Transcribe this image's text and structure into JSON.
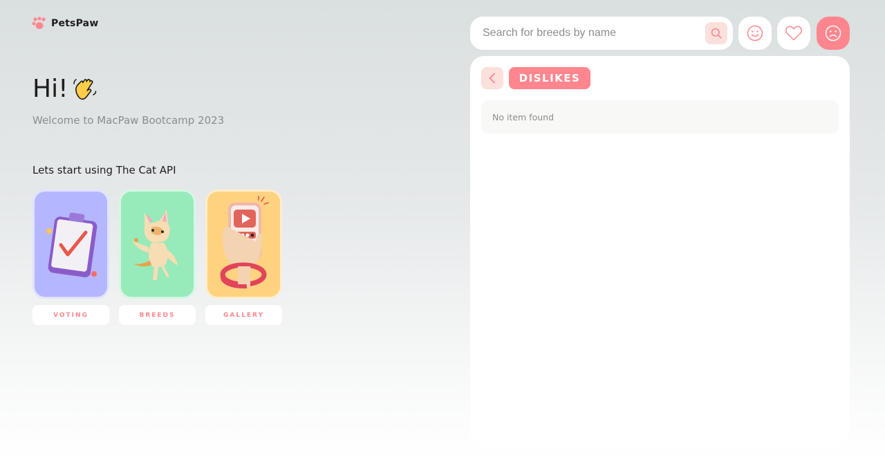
{
  "brand": {
    "name": "PetsPaw",
    "accent": "#ff868e",
    "accent_light": "#fbe0dc"
  },
  "hero": {
    "greeting": "Hi!",
    "wave_icon": "waving-hand-icon",
    "subtitle": "Welcome to MacPaw Bootcamp 2023"
  },
  "start": {
    "label": "Lets start using The Cat API"
  },
  "cards": [
    {
      "label": "VOTING",
      "color": "#b4b7ff",
      "icon": "clipboard-vote-illustration"
    },
    {
      "label": "BREEDS",
      "color": "#97eab9",
      "icon": "cat-illustration"
    },
    {
      "label": "GALLERY",
      "color": "#ffd280",
      "icon": "phone-gallery-illustration"
    }
  ],
  "search": {
    "placeholder": "Search for breeds by name",
    "value": "",
    "icon": "search-icon"
  },
  "header_icons": [
    {
      "name": "likes",
      "icon": "smile-icon"
    },
    {
      "name": "favourites",
      "icon": "heart-icon"
    },
    {
      "name": "dislikes",
      "icon": "sad-face-icon",
      "active": true
    }
  ],
  "panel": {
    "back_icon": "chevron-left-icon",
    "page_label": "DISLIKES",
    "empty_message": "No item found"
  }
}
